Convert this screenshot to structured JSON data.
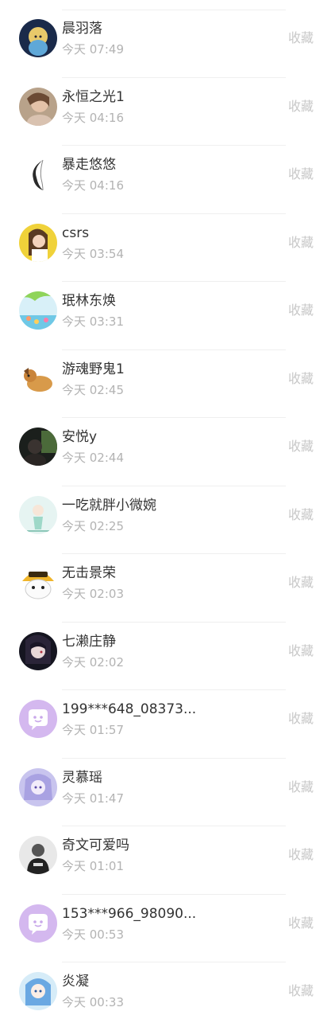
{
  "collect_label": "收藏",
  "contacts": [
    {
      "name": "晨羽落",
      "time": "今天 07:49",
      "avatar_icon": "anime-girl-avatar-icon"
    },
    {
      "name": "永恒之光1",
      "time": "今天 04:16",
      "avatar_icon": "portrait-photo-avatar-icon"
    },
    {
      "name": "暴走悠悠",
      "time": "今天 04:16",
      "avatar_icon": "feather-avatar-icon"
    },
    {
      "name": "csrs",
      "time": "今天 03:54",
      "avatar_icon": "portrait-photo-avatar-icon"
    },
    {
      "name": "珉林东焕",
      "time": "今天 03:31",
      "avatar_icon": "beach-scene-avatar-icon"
    },
    {
      "name": "游魂野鬼1",
      "time": "今天 02:45",
      "avatar_icon": "cartoon-dog-avatar-icon"
    },
    {
      "name": "安悦y",
      "time": "今天 02:44",
      "avatar_icon": "dark-photo-avatar-icon"
    },
    {
      "name": "一吃就胖小微婉",
      "time": "今天 02:25",
      "avatar_icon": "illustration-avatar-icon"
    },
    {
      "name": "无击景荣",
      "time": "今天 02:03",
      "avatar_icon": "cartoon-emoji-avatar-icon"
    },
    {
      "name": "七濑庄静",
      "time": "今天 02:02",
      "avatar_icon": "anime-dark-avatar-icon"
    },
    {
      "name": "199***648_08373...",
      "time": "今天 01:57",
      "avatar_icon": "chat-bubble-default-avatar-icon"
    },
    {
      "name": "灵慕瑶",
      "time": "今天 01:47",
      "avatar_icon": "anime-lavender-avatar-icon"
    },
    {
      "name": "奇文可爱吗",
      "time": "今天 01:01",
      "avatar_icon": "bw-photo-avatar-icon"
    },
    {
      "name": "153***966_98090...",
      "time": "今天 00:53",
      "avatar_icon": "chat-bubble-default-avatar-icon"
    },
    {
      "name": "炎凝",
      "time": "今天 00:33",
      "avatar_icon": "anime-blue-avatar-icon"
    }
  ]
}
